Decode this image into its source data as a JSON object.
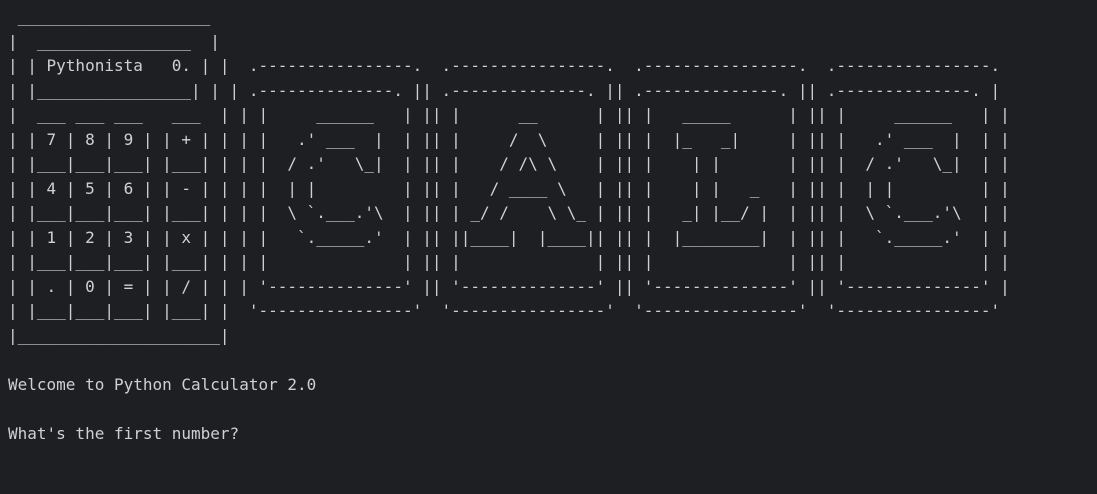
{
  "terminal": {
    "lines": [
      " ____________________",
      "|  ________________  |",
      "| | Pythonista   0. | |  .----------------.  .----------------.  .----------------.  .----------------.",
      "| |________________| | | .--------------. || .--------------. || .--------------. || .--------------. |",
      "|  ___ ___ ___   ___  | | |     ______   | || |      __      | || |   _____      | || |     ______   | |",
      "| | 7 | 8 | 9 | | + | | | |   .' ___  |  | || |     /  \\     | || |  |_   _|     | || |   .' ___  |  | |",
      "| |___|___|___| |___| | | |  / .'   \\_|  | || |    / /\\ \\    | || |    | |       | || |  / .'   \\_|  | |",
      "| | 4 | 5 | 6 | | - | | | |  | |         | || |   / ____ \\   | || |    | |   _   | || |  | |         | |",
      "| |___|___|___| |___| | | |  \\ `.___.'\\  | || | _/ /    \\ \\_ | || |   _| |__/ |  | || |  \\ `.___.'\\  | |",
      "| | 1 | 2 | 3 | | x | | | |   `._____.'  | || ||____|  |____|| || |  |________|  | || |   `._____.'  | |",
      "| |___|___|___| |___| | | |              | || |              | || |              | || |              | |",
      "| | . | 0 | = | | / | | | '--------------' || '--------------' || '--------------' || '--------------' |",
      "| |___|___|___| |___| |  '----------------'  '----------------'  '----------------'  '----------------'",
      "|_____________________|",
      "",
      "Welcome to Python Calculator 2.0",
      "",
      "What's the first number?"
    ]
  }
}
